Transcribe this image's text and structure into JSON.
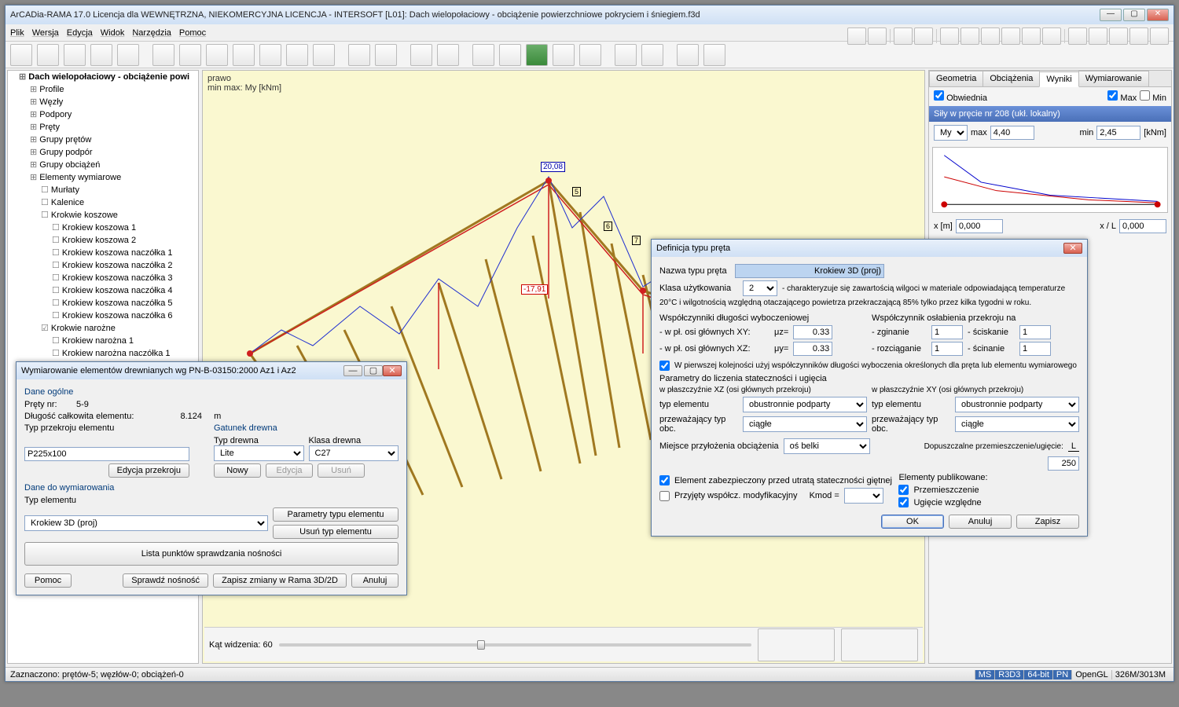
{
  "title": "ArCADia-RAMA 17.0 Licencja dla WEWNĘTRZNA, NIEKOMERCYJNA LICENCJA - INTERSOFT [L01]: Dach wielopołaciowy - obciążenie powierzchniowe pokryciem i śniegiem.f3d",
  "menus": [
    "Plik",
    "Wersja",
    "Edycja",
    "Widok",
    "Narzędzia",
    "Pomoc"
  ],
  "tree_root": "Dach wielopołaciowy - obciążenie powi",
  "tree": [
    "Profile",
    "Węzły",
    "Podpory",
    "Pręty",
    "Grupy prętów",
    "Grupy podpór",
    "Grupy obciążeń",
    "Elementy wymiarowe"
  ],
  "tree_elem": [
    "Murłaty",
    "Kalenice"
  ],
  "tree_kosz_label": "Krokwie koszowe",
  "tree_kosz": [
    "Krokiew koszowa 1",
    "Krokiew koszowa 2",
    "Krokiew koszowa naczółka 1",
    "Krokiew koszowa naczółka 2",
    "Krokiew koszowa naczółka 3",
    "Krokiew koszowa naczółka 4",
    "Krokiew koszowa naczółka 5",
    "Krokiew koszowa naczółka 6"
  ],
  "tree_naroz_label": "Krokwie narożne",
  "tree_naroz": [
    "Krokiew narożna 1",
    "Krokiew narożna naczółka 1"
  ],
  "viewport": {
    "line1": "prawo",
    "line2": "min max: My [kNm]",
    "pos_val": "20,08",
    "neg_val": "-17,91",
    "nodes": [
      "5",
      "6",
      "7"
    ],
    "footer_label": "Kąt widzenia: 60"
  },
  "tabs": [
    "Geometria",
    "Obciążenia",
    "Wyniki",
    "Wymiarowanie"
  ],
  "right": {
    "obw": "Obwiednia",
    "max": "Max",
    "min": "Min",
    "band": "Siły w pręcie nr 208 (ukł. lokalny)",
    "qty": "My",
    "maxlbl": "max",
    "maxval": "4,40",
    "minlbl": "min",
    "minval": "2,45",
    "unit": "[kNm]",
    "xlbl": "x [m]",
    "xval": "0,000",
    "xLlbl": "x / L",
    "xLval": "0,000"
  },
  "status": {
    "left": "Zaznaczono: prętów-5; węzłów-0; obciążeń-0",
    "cells": [
      "MS",
      "R3D3",
      "64-bit",
      "PN",
      "OpenGL",
      "326M/3013M"
    ]
  },
  "dim": {
    "title": "Wymiarowanie elementów drewnianych wg PN-B-03150:2000 Az1 i Az2",
    "sec1": "Dane ogólne",
    "prety_lbl": "Pręty nr:",
    "prety_val": "5-9",
    "len_lbl": "Długość całkowita elementu:",
    "len_val": "8.124",
    "len_unit": "m",
    "przek_lbl": "Typ przekroju elementu",
    "przek_val": "P225x100",
    "edycja_przek": "Edycja przekroju",
    "gatunek": "Gatunek drewna",
    "typ_drewna_lbl": "Typ drewna",
    "typ_drewna_val": "Lite",
    "klasa_drewna_lbl": "Klasa drewna",
    "klasa_drewna_val": "C27",
    "nowy": "Nowy",
    "edycja": "Edycja",
    "usun": "Usuń",
    "sec2": "Dane do wymiarowania",
    "typelem_lbl": "Typ elementu",
    "typelem_val": "Krokiew 3D (proj)",
    "param_btn": "Parametry typu elementu",
    "usun_typ": "Usuń typ elementu",
    "lista_btn": "Lista punktów sprawdzania nośności",
    "pomoc": "Pomoc",
    "sprawdz": "Sprawdź nośność",
    "zapisz": "Zapisz zmiany w Rama 3D/2D",
    "anuluj": "Anuluj"
  },
  "def": {
    "title": "Definicja typu pręta",
    "name_lbl": "Nazwa typu pręta",
    "name_val": "Krokiew 3D (proj)",
    "klasa_lbl": "Klasa użytkowania",
    "klasa_val": "2",
    "klasa_desc1": "- charakteryzuje się zawartością wilgoci w materiale odpowiadającą temperaturze",
    "klasa_desc2": "20°C i wilgotnością względną otaczającego powietrza przekraczającą 85% tylko przez kilka tygodni w roku.",
    "wsp_head": "Współczynniki długości wyboczeniowej",
    "xy_lbl": "- w pł. osi głównych XY:",
    "xy_sym": "μz=",
    "xy_val": "0.33",
    "xz_lbl": "- w pł. osi głównych XZ:",
    "xz_sym": "μy=",
    "xz_val": "0.33",
    "osl_head": "Współczynnik osłabienia przekroju na",
    "zgin": "- zginanie",
    "zgin_v": "1",
    "rozc": "- rozciąganie",
    "rozc_v": "1",
    "scisk": "- ściskanie",
    "scisk_v": "1",
    "scin": "- ścinanie",
    "scin_v": "1",
    "chk1": "W pierwszej kolejności użyj współczynników długości wyboczenia określonych dla pręta lub elementu wymiarowego",
    "param_head": "Parametry do liczenia stateczności i ugięcia",
    "xz_head": "w płaszczyźnie XZ (osi głównych przekroju)",
    "xy_head": "w płaszczyźnie XY (osi głównych przekroju)",
    "typel": "typ elementu",
    "typel_v": "obustronnie podparty",
    "przew": "przeważający typ obc.",
    "przew_v": "ciągłe",
    "miejsce": "Miejsce przyłożenia obciążenia",
    "miejsce_v": "oś belki",
    "dopusz": "Dopuszczalne przemieszczenie/ugięcie:",
    "dopusz_v": "250",
    "dopusz_sym": "L",
    "chk_elem": "Element zabezpieczony przed utratą stateczności giętnej",
    "chk_przyj": "Przyjęty współcz. modyfikacyjny",
    "kmod": "Kmod =",
    "elempub": "Elementy publikowane:",
    "przem": "Przemieszczenie",
    "ugie": "Ugięcie względne",
    "ok": "OK",
    "anuluj": "Anuluj",
    "zapisz": "Zapisz"
  }
}
